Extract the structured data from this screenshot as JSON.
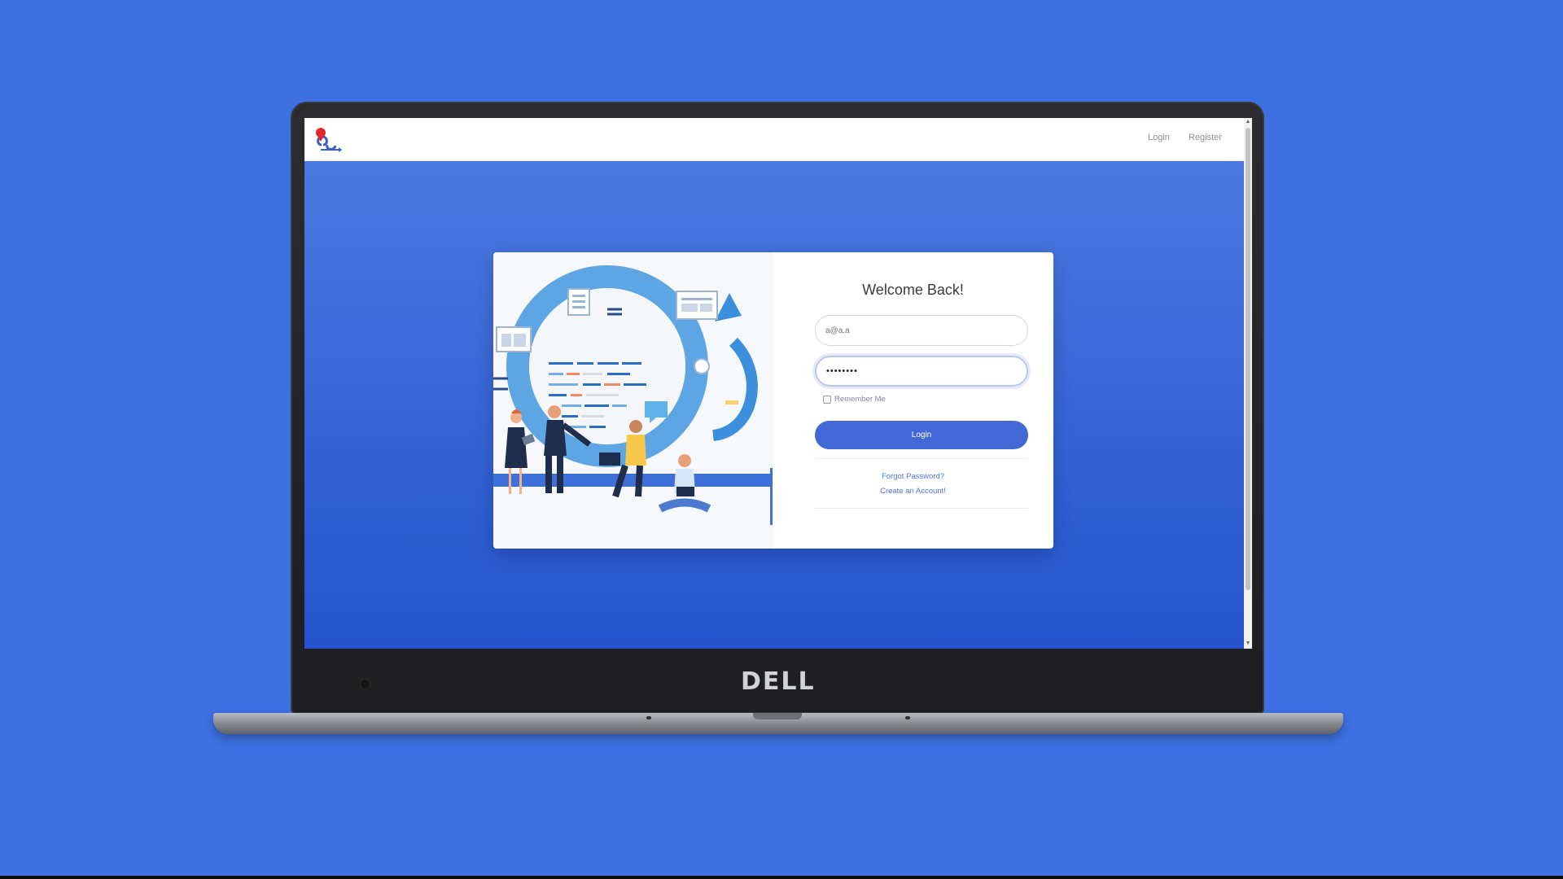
{
  "navbar": {
    "login_label": "Login",
    "register_label": "Register"
  },
  "card": {
    "title": "Welcome Back!",
    "email_value": "a@a.a",
    "password_mask": "••••••••",
    "remember_label": "Remember Me",
    "remember_checked": false,
    "login_button_label": "Login",
    "forgot_password_label": "Forgot Password?",
    "create_account_label": "Create an Account!"
  },
  "device": {
    "brand": "DELL"
  },
  "colors": {
    "background": "#3d70e0",
    "primary": "#4268d6",
    "link": "#4e73df"
  },
  "icons": {
    "brand_logo": "brand-logo-icon",
    "scroll_up": "scroll-up-arrow",
    "scroll_down": "scroll-down-arrow"
  }
}
